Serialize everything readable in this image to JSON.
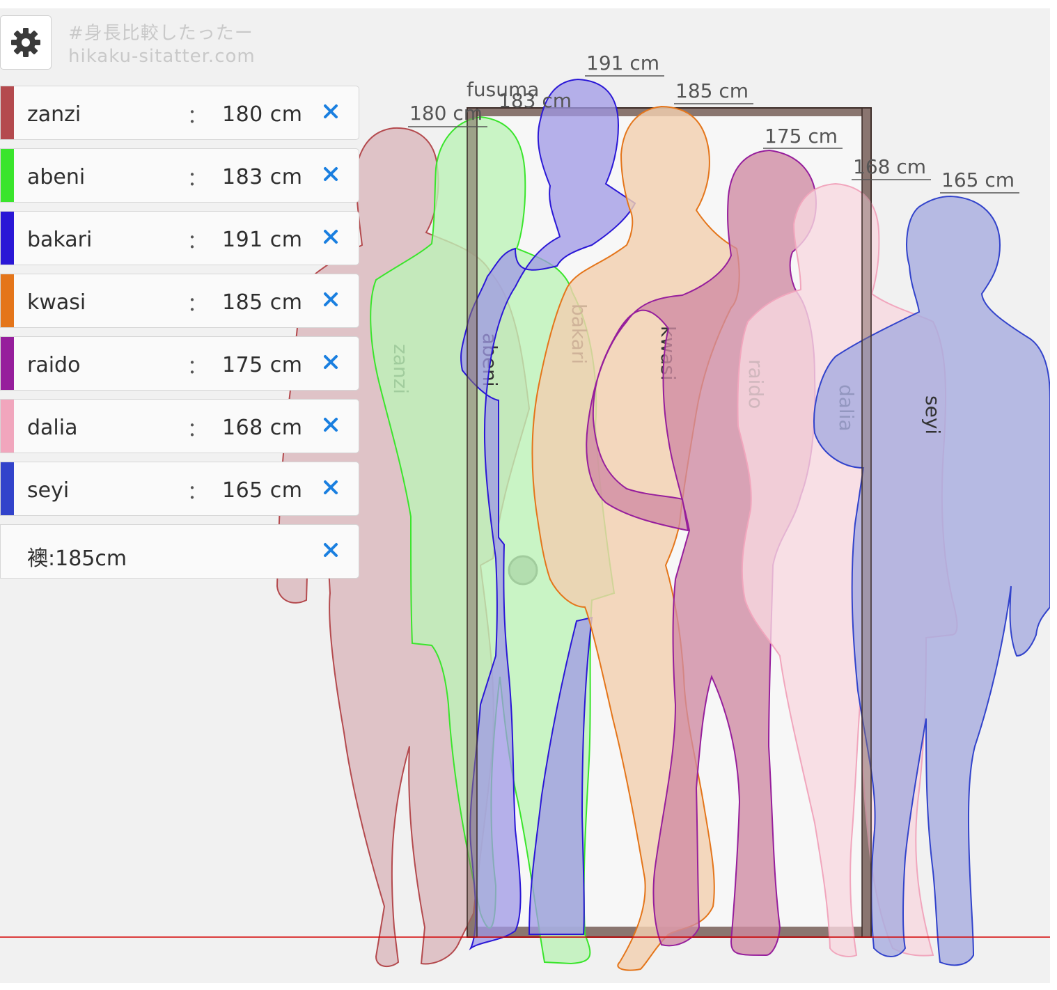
{
  "brand": {
    "line1": "#身長比較したったー",
    "line2": "hikaku-sitatter.com"
  },
  "settings": {
    "icon": "gear-icon"
  },
  "people": [
    {
      "name": "zanzi",
      "height": "180 cm",
      "color": "#b44a4e",
      "fill": "#dcbcc0"
    },
    {
      "name": "abeni",
      "height": "183 cm",
      "color": "#3ae52c",
      "fill": "#bdf2b8"
    },
    {
      "name": "bakari",
      "height": "191 cm",
      "color": "#2a17d6",
      "fill": "#b7b2ec"
    },
    {
      "name": "kwasi",
      "height": "185 cm",
      "color": "#e4751a",
      "fill": "#f1cfb0"
    },
    {
      "name": "raido",
      "height": "175 cm",
      "color": "#961e9c",
      "fill": "#dbb4da"
    },
    {
      "name": "dalia",
      "height": "168 cm",
      "color": "#f1a6bd",
      "fill": "#f7d8e0"
    },
    {
      "name": "seyi",
      "height": "165 cm",
      "color": "#3243cb",
      "fill": "#b9bde5"
    }
  ],
  "fusuma": {
    "list_label": "襖:185cm",
    "label": "fusuma",
    "frame_color": "#8a7670"
  },
  "colon": "：",
  "remove_icon": "close-icon",
  "ground_line_color": "#d40000"
}
